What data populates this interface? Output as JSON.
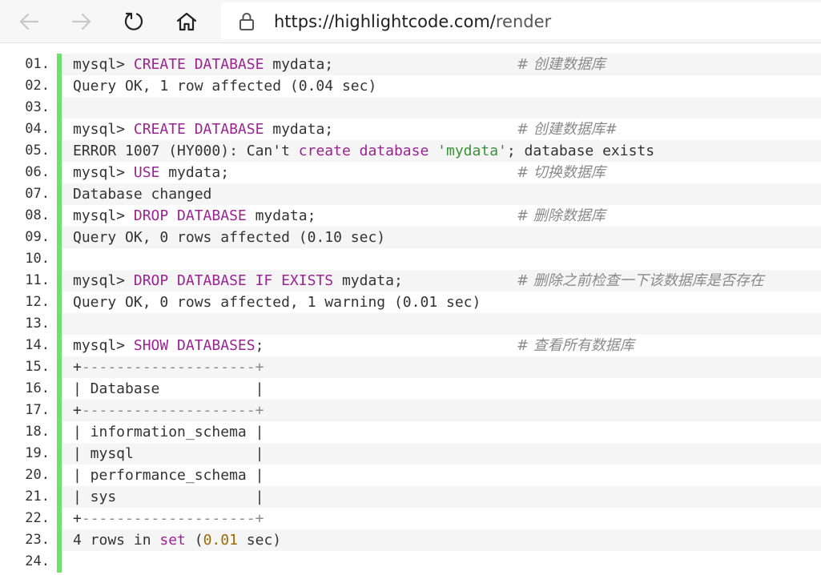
{
  "browser": {
    "back_icon": "back-arrow-icon",
    "forward_icon": "forward-arrow-icon",
    "refresh_icon": "refresh-icon",
    "home_icon": "home-icon",
    "lock_icon": "lock-icon",
    "url_host": "https://highlightcode.com/",
    "url_path": "render"
  },
  "code": {
    "accent_bar_color": "#6ce26c",
    "lines": [
      {
        "num": "01.",
        "segments": [
          {
            "t": "mysql> "
          },
          {
            "t": "CREATE DATABASE",
            "k": "keyword"
          },
          {
            "t": " mydata;"
          }
        ],
        "comment": "# 创建数据库"
      },
      {
        "num": "02.",
        "segments": [
          {
            "t": "Query OK, 1 row affected (0.04 sec)"
          }
        ],
        "comment": ""
      },
      {
        "num": "03.",
        "segments": [],
        "comment": ""
      },
      {
        "num": "04.",
        "segments": [
          {
            "t": "mysql> "
          },
          {
            "t": "CREATE DATABASE",
            "k": "keyword"
          },
          {
            "t": " mydata;"
          }
        ],
        "comment": "# 创建数据库#"
      },
      {
        "num": "05.",
        "segments": [
          {
            "t": "ERROR 1007 (HY000): Can't "
          },
          {
            "t": "create database",
            "k": "keyword"
          },
          {
            "t": " "
          },
          {
            "t": "'mydata'",
            "k": "string"
          },
          {
            "t": "; database exists"
          }
        ],
        "comment": ""
      },
      {
        "num": "06.",
        "segments": [
          {
            "t": "mysql> "
          },
          {
            "t": "USE",
            "k": "keyword"
          },
          {
            "t": " mydata;"
          }
        ],
        "comment": "# 切换数据库"
      },
      {
        "num": "07.",
        "segments": [
          {
            "t": "Database changed"
          }
        ],
        "comment": ""
      },
      {
        "num": "08.",
        "segments": [
          {
            "t": "mysql> "
          },
          {
            "t": "DROP DATABASE",
            "k": "keyword"
          },
          {
            "t": " mydata;"
          }
        ],
        "comment": "# 删除数据库"
      },
      {
        "num": "09.",
        "segments": [
          {
            "t": "Query OK, 0 rows affected (0.10 sec)"
          }
        ],
        "comment": ""
      },
      {
        "num": "10.",
        "segments": [],
        "comment": ""
      },
      {
        "num": "11.",
        "segments": [
          {
            "t": "mysql> "
          },
          {
            "t": "DROP DATABASE IF EXISTS",
            "k": "keyword"
          },
          {
            "t": " mydata;"
          }
        ],
        "comment": "# 删除之前检查一下该数据库是否存在"
      },
      {
        "num": "12.",
        "segments": [
          {
            "t": "Query OK, 0 rows affected, 1 warning (0.01 sec)"
          }
        ],
        "comment": ""
      },
      {
        "num": "13.",
        "segments": [],
        "comment": ""
      },
      {
        "num": "14.",
        "segments": [
          {
            "t": "mysql> "
          },
          {
            "t": "SHOW DATABASES",
            "k": "keyword"
          },
          {
            "t": ";"
          }
        ],
        "comment": "# 查看所有数据库"
      },
      {
        "num": "15.",
        "segments": [
          {
            "t": "+"
          },
          {
            "t": "--------------------",
            "k": "gray"
          },
          {
            "t": "+",
            "k": "gray"
          }
        ],
        "comment": ""
      },
      {
        "num": "16.",
        "segments": [
          {
            "t": "| Database           |"
          }
        ],
        "comment": ""
      },
      {
        "num": "17.",
        "segments": [
          {
            "t": "+"
          },
          {
            "t": "--------------------",
            "k": "gray"
          },
          {
            "t": "+",
            "k": "gray"
          }
        ],
        "comment": ""
      },
      {
        "num": "18.",
        "segments": [
          {
            "t": "| information_schema |"
          }
        ],
        "comment": ""
      },
      {
        "num": "19.",
        "segments": [
          {
            "t": "| mysql              |"
          }
        ],
        "comment": ""
      },
      {
        "num": "20.",
        "segments": [
          {
            "t": "| performance_schema |"
          }
        ],
        "comment": ""
      },
      {
        "num": "21.",
        "segments": [
          {
            "t": "| sys                |"
          }
        ],
        "comment": ""
      },
      {
        "num": "22.",
        "segments": [
          {
            "t": "+"
          },
          {
            "t": "--------------------",
            "k": "gray"
          },
          {
            "t": "+",
            "k": "gray"
          }
        ],
        "comment": ""
      },
      {
        "num": "23.",
        "segments": [
          {
            "t": "4 rows in "
          },
          {
            "t": "set",
            "k": "keyword"
          },
          {
            "t": " ("
          },
          {
            "t": "0.01",
            "k": "number"
          },
          {
            "t": " sec)"
          }
        ],
        "comment": ""
      },
      {
        "num": "24.",
        "segments": [],
        "comment": ""
      }
    ]
  }
}
